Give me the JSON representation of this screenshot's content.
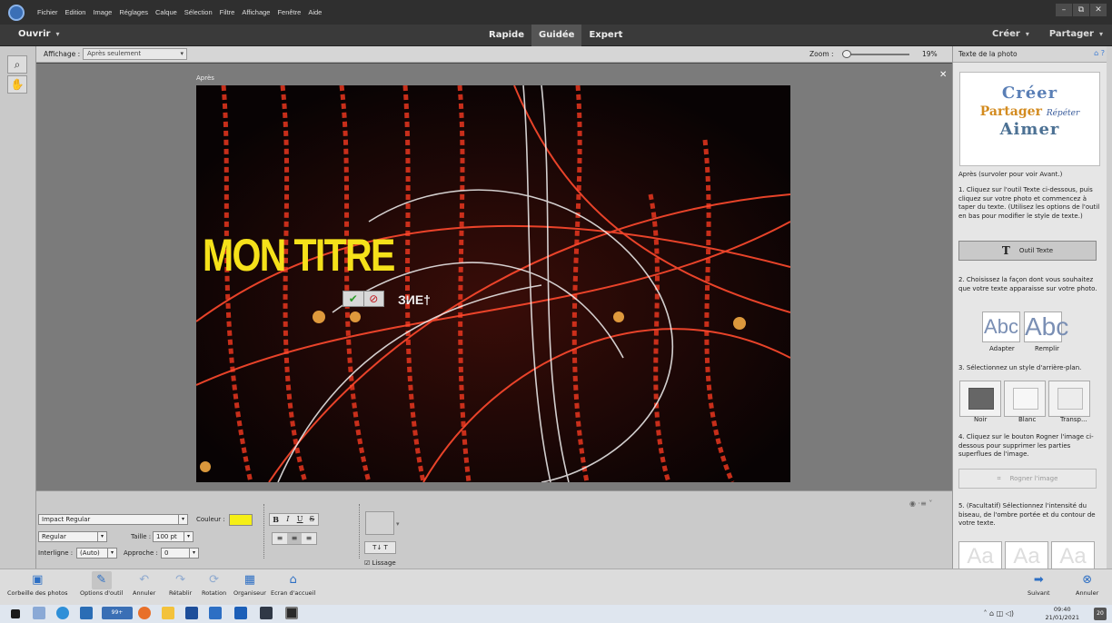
{
  "menubar": {
    "items": [
      "Fichier",
      "Edition",
      "Image",
      "Réglages",
      "Calque",
      "Sélection",
      "Filtre",
      "Affichage",
      "Fenêtre",
      "Aide"
    ],
    "window_controls": [
      "–",
      "⧉",
      "✕"
    ]
  },
  "modebar": {
    "open_label": "Ouvrir",
    "modes": [
      "Rapide",
      "Guidée",
      "Expert"
    ],
    "active_mode": "Guidée",
    "create_label": "Créer",
    "share_label": "Partager"
  },
  "options": {
    "view_label": "Affichage :",
    "view_value": "Après seulement",
    "zoom_label": "Zoom :",
    "zoom_value": "19%",
    "zoom_fraction": 0.19
  },
  "canvas": {
    "label": "Après",
    "close": "✕",
    "title_text": "MON TITRE",
    "typed_text": "ЗИЕ†"
  },
  "text_options": {
    "font_family": "Impact Regular",
    "font_style": "Regular",
    "size_label": "Taille :",
    "size_value": "100 pt",
    "color_label": "Couleur :",
    "color_value": "#f5ef16",
    "leading_label": "Interligne :",
    "leading_value": "(Auto)",
    "tracking_label": "Approche :",
    "tracking_value": "0",
    "format_buttons": [
      "B",
      "I",
      "U",
      "S"
    ],
    "align_buttons": [
      "≡",
      "≡",
      "≡"
    ],
    "orientation_label": "T↓ T",
    "antialias_label": "Lissage",
    "antialias_checked": true
  },
  "right_panel": {
    "title": "Texte de la photo",
    "preview": {
      "line1": "Créer",
      "line2": "Partager",
      "line2b": "Répéter",
      "line3": "Aimer"
    },
    "after_hint": "Après (survoler pour voir Avant.)",
    "step1": "1. Cliquez sur l'outil Texte ci-dessous, puis cliquez sur votre photo et commencez à taper du texte. (Utilisez les options de l'outil en bas pour modifier le style de texte.)",
    "text_tool_icon": "T",
    "text_tool_label": "Outil Texte",
    "step2": "2. Choisissez la façon dont vous souhaitez que votre texte apparaisse sur votre photo.",
    "fit_icon": "Abc",
    "fill_icon": "Abc",
    "fit_label": "Adapter",
    "fill_label": "Remplir",
    "step3": "3. Sélectionnez un style d'arrière-plan.",
    "bg_styles": [
      "Noir",
      "Blanc",
      "Transp..."
    ],
    "step4": "4. Cliquez sur le bouton Rogner l'image ci-dessous pour supprimer les parties superflues de l'image.",
    "crop_label": "Rogner l'image",
    "step5": "5. (Facultatif) Sélectionnez l'intensité du biseau, de l'ombre portée et du contour de votre texte.",
    "bevel_samples": [
      "Aa",
      "Aa",
      "Aa"
    ]
  },
  "actionbar": {
    "items": [
      "Corbeille des photos",
      "Options d'outil",
      "Annuler",
      "Rétablir",
      "Rotation",
      "Organiseur",
      "Ecran d'accueil"
    ],
    "next_label": "Suivant",
    "cancel_label": "Annuler"
  },
  "taskbar": {
    "time": "09:40",
    "date": "21/01/2021",
    "badge": "99+",
    "notifications": "20"
  }
}
